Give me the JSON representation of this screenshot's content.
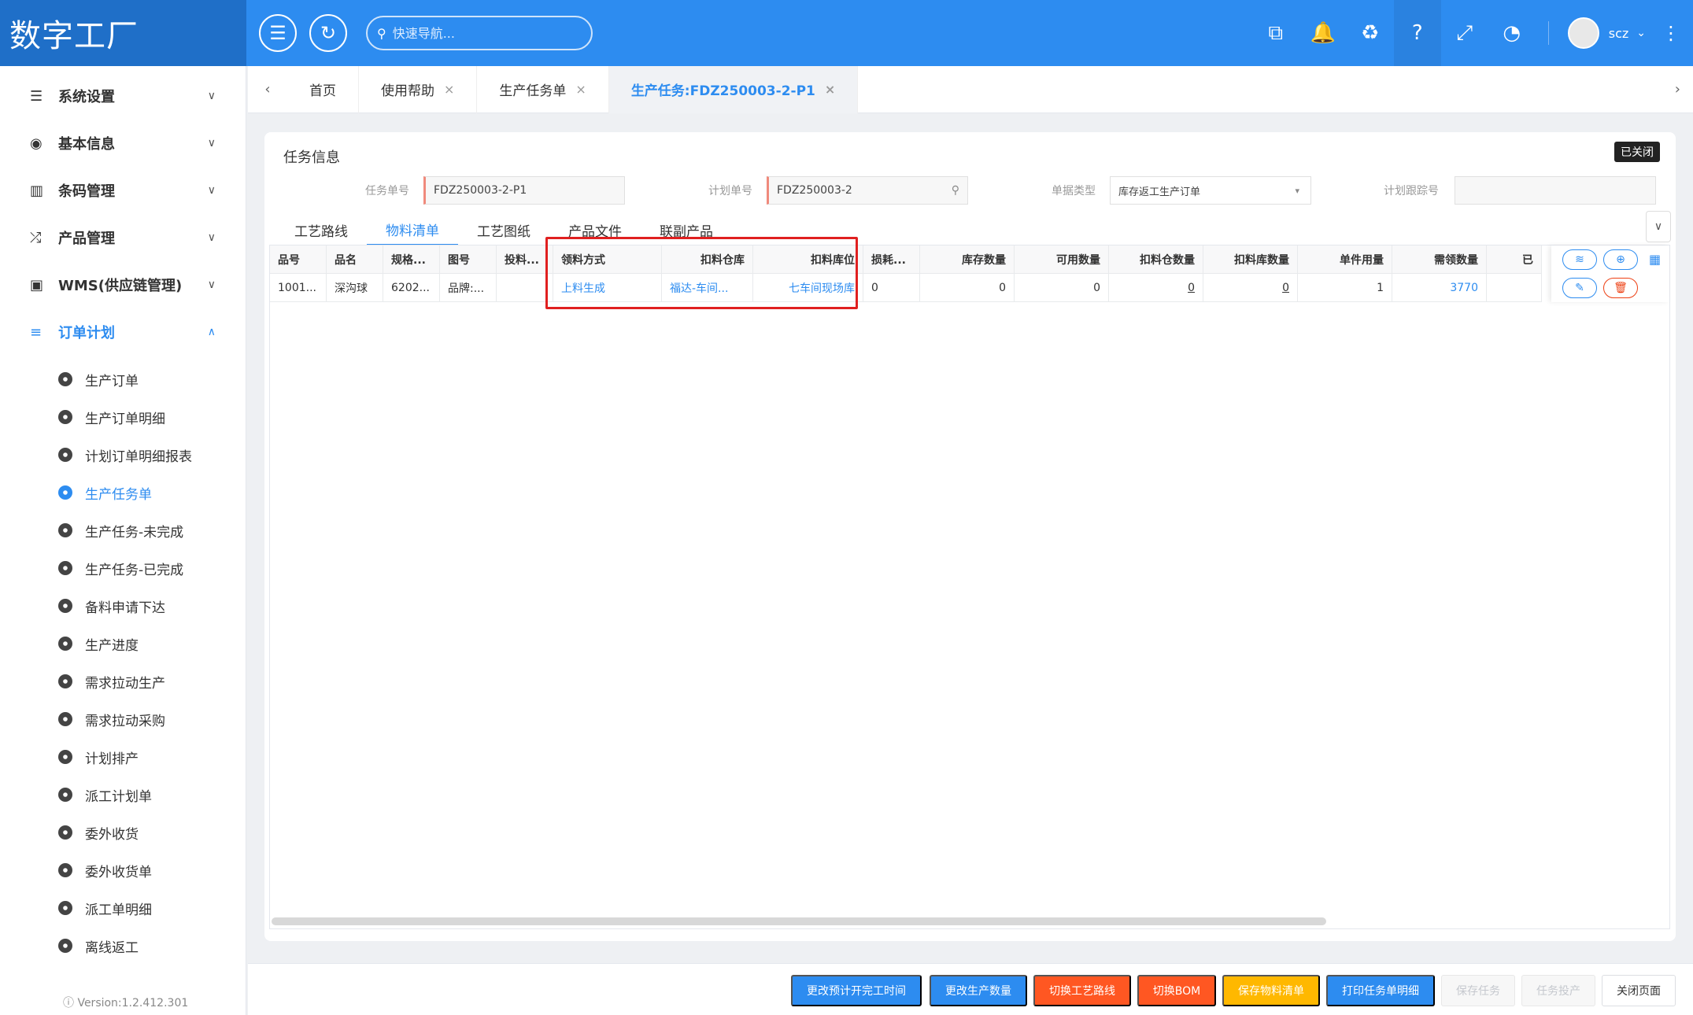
{
  "app": {
    "logo": "数字工厂"
  },
  "header": {
    "search_placeholder": "快速导航...",
    "username": "scz"
  },
  "sidebar": {
    "groups": [
      {
        "label": "系统设置"
      },
      {
        "label": "基本信息"
      },
      {
        "label": "条码管理"
      },
      {
        "label": "产品管理"
      },
      {
        "label": "WMS(供应链管理)"
      },
      {
        "label": "订单计划"
      }
    ],
    "sub_items": [
      "生产订单",
      "生产订单明细",
      "计划订单明细报表",
      "生产任务单",
      "生产任务-未完成",
      "生产任务-已完成",
      "备料申请下达",
      "生产进度",
      "需求拉动生产",
      "需求拉动采购",
      "计划排产",
      "派工计划单",
      "委外收货",
      "委外收货单",
      "派工单明细",
      "离线返工"
    ],
    "version": "Version:1.2.412.301"
  },
  "tabs": [
    {
      "label": "首页"
    },
    {
      "label": "使用帮助"
    },
    {
      "label": "生产任务单"
    },
    {
      "label": "生产任务:FDZ250003-2-P1"
    }
  ],
  "card": {
    "title": "任务信息",
    "status_badge": "已关闭",
    "fields": {
      "task_no_label": "任务单号",
      "task_no": "FDZ250003-2-P1",
      "plan_no_label": "计划单号",
      "plan_no": "FDZ250003-2",
      "doc_type_label": "单据类型",
      "doc_type": "库存返工生产订单",
      "track_no_label": "计划跟踪号",
      "track_no": ""
    },
    "subtabs": [
      "工艺路线",
      "物料清单",
      "工艺图纸",
      "产品文件",
      "联副产品"
    ]
  },
  "table": {
    "headers": [
      "品号",
      "品名",
      "规格...",
      "图号",
      "投料...",
      "领料方式",
      "扣料仓库",
      "扣料库位",
      "损耗...",
      "库存数量",
      "可用数量",
      "扣料仓数量",
      "扣料库数量",
      "单件用量",
      "需领数量",
      "已"
    ],
    "row": [
      "1001...",
      "深沟球",
      "6202...",
      "品牌:...",
      "",
      "上料生成",
      "福达-车间...",
      "七车间现场库",
      "0",
      "0",
      "0",
      "0",
      "0",
      "1",
      "3770",
      ""
    ]
  },
  "bottom_buttons": [
    "更改预计开完工时间",
    "更改生产数量",
    "切换工艺路线",
    "切换BOM",
    "保存物料清单",
    "打印任务单明细",
    "保存任务",
    "任务投产",
    "关闭页面"
  ]
}
